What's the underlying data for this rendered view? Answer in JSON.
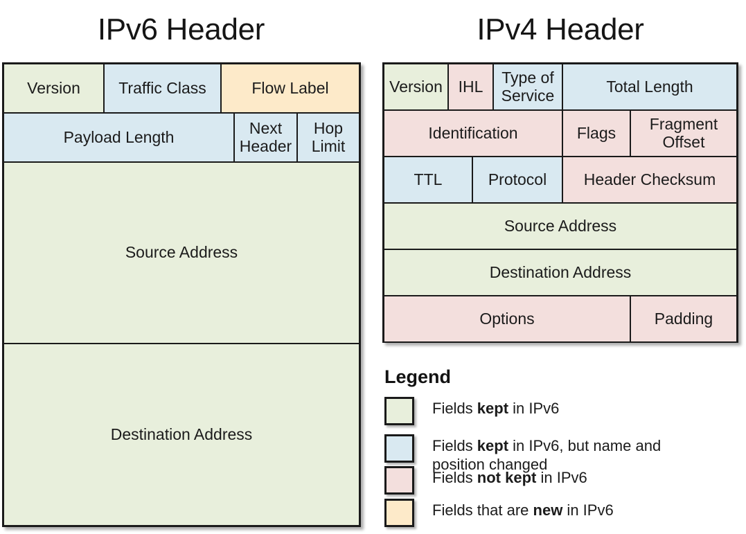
{
  "titles": {
    "ipv6": "IPv6 Header",
    "ipv4": "IPv4 Header"
  },
  "colors": {
    "kept": "#e8efdc",
    "kept_changed": "#d9e9f1",
    "not_kept": "#f3dfdd",
    "new": "#fdeac9",
    "border": "#1a1a1a",
    "text": "#1b1b1b",
    "background": "#ffffff"
  },
  "ipv6_header": {
    "rows": [
      {
        "cells": [
          {
            "label": "Version",
            "color": "kept"
          },
          {
            "label": "Traffic Class",
            "color": "kept_changed"
          },
          {
            "label": "Flow Label",
            "color": "new"
          }
        ]
      },
      {
        "cells": [
          {
            "label": "Payload Length",
            "color": "kept_changed"
          },
          {
            "label": "Next Header",
            "color": "kept_changed"
          },
          {
            "label": "Hop Limit",
            "color": "kept_changed"
          }
        ]
      },
      {
        "cells": [
          {
            "label": "Source Address",
            "color": "kept"
          }
        ]
      },
      {
        "cells": [
          {
            "label": "Destination Address",
            "color": "kept"
          }
        ]
      }
    ]
  },
  "ipv4_header": {
    "rows": [
      {
        "cells": [
          {
            "label": "Version",
            "color": "kept"
          },
          {
            "label": "IHL",
            "color": "not_kept"
          },
          {
            "label": "Type of Service",
            "color": "kept_changed"
          },
          {
            "label": "Total Length",
            "color": "kept_changed"
          }
        ]
      },
      {
        "cells": [
          {
            "label": "Identification",
            "color": "not_kept"
          },
          {
            "label": "Flags",
            "color": "not_kept"
          },
          {
            "label": "Fragment Offset",
            "color": "not_kept"
          }
        ]
      },
      {
        "cells": [
          {
            "label": "TTL",
            "color": "kept_changed"
          },
          {
            "label": "Protocol",
            "color": "kept_changed"
          },
          {
            "label": "Header Checksum",
            "color": "not_kept"
          }
        ]
      },
      {
        "cells": [
          {
            "label": "Source Address",
            "color": "kept"
          }
        ]
      },
      {
        "cells": [
          {
            "label": "Destination Address",
            "color": "kept"
          }
        ]
      },
      {
        "cells": [
          {
            "label": "Options",
            "color": "not_kept"
          },
          {
            "label": "Padding",
            "color": "not_kept"
          }
        ]
      }
    ]
  },
  "legend": {
    "title": "Legend",
    "items": [
      {
        "color": "kept",
        "text_pre": "Fields ",
        "text_bold": "kept",
        "text_post": " in IPv6"
      },
      {
        "color": "kept_changed",
        "text_pre": "Fields ",
        "text_bold": "kept",
        "text_post": " in IPv6, but name and position changed"
      },
      {
        "color": "not_kept",
        "text_pre": "Fields ",
        "text_bold": "not kept",
        "text_post": " in IPv6"
      },
      {
        "color": "new",
        "text_pre": "Fields that are ",
        "text_bold": "new",
        "text_post": " in IPv6"
      }
    ]
  }
}
